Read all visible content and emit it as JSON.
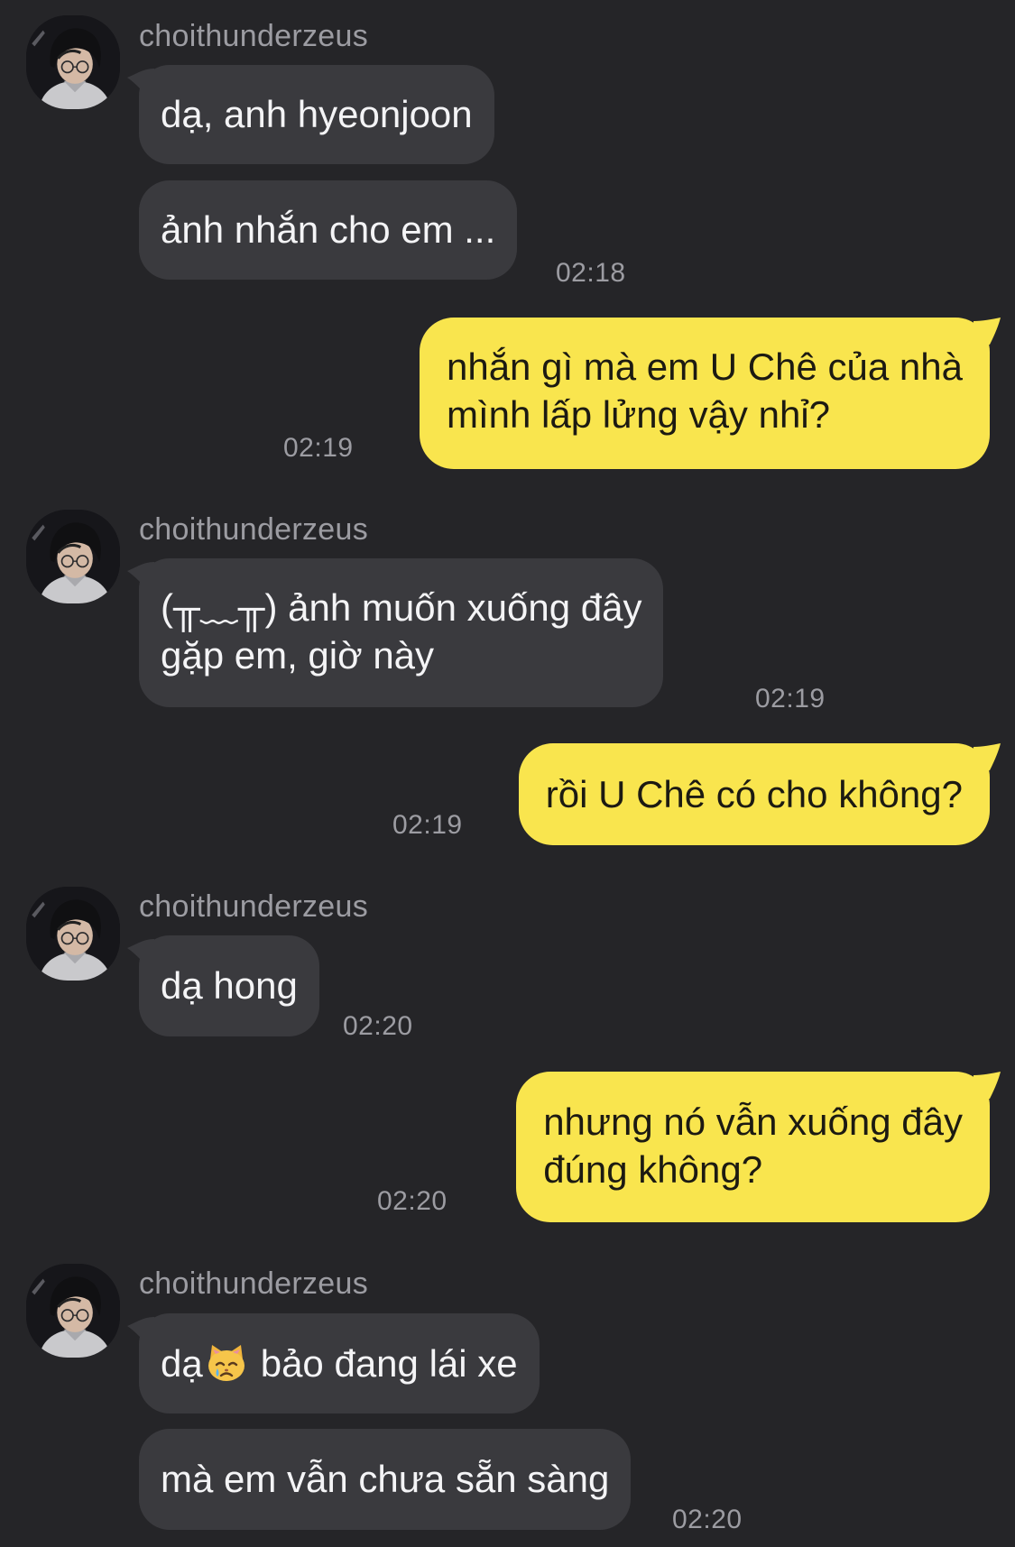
{
  "sender": {
    "name": "choithunderzeus"
  },
  "messages": [
    {
      "text": "dạ, anh hyeonjoon"
    },
    {
      "text": "ảnh nhắn cho em ...",
      "time": "02:18"
    },
    {
      "line1": "nhắn gì mà em U Chê của nhà",
      "line2": "mình lấp lửng vậy nhỉ?",
      "time": "02:19"
    },
    {
      "line1": "(╥﹏╥) ảnh muốn xuống đây",
      "line2": "gặp em, giờ này",
      "time": "02:19"
    },
    {
      "text": "rồi U Chê có cho không?",
      "time": "02:19"
    },
    {
      "text": "dạ hong",
      "time": "02:20"
    },
    {
      "line1": "nhưng nó vẫn xuống đây",
      "line2": "đúng không?",
      "time": "02:20"
    },
    {
      "before": "dạ",
      "emoji": "crying-cat-face",
      "after": "bảo đang lái xe"
    },
    {
      "text": "mà em vẫn chưa sẵn sàng",
      "time": "02:20"
    }
  ],
  "colors": {
    "background": "#252528",
    "incoming_bubble": "#3a3a3e",
    "outgoing_bubble": "#f9e54e",
    "meta_text": "#9c9ca2"
  }
}
